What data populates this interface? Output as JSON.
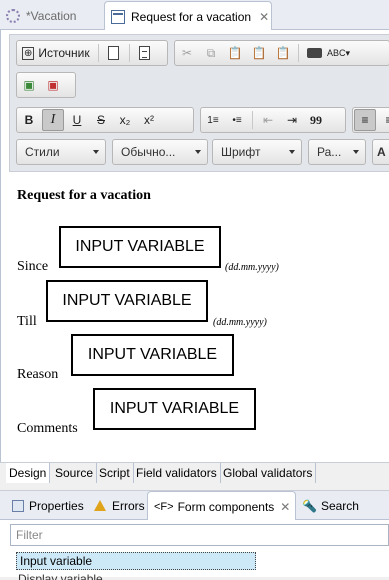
{
  "editor_tabs": [
    {
      "label": "*Vacation",
      "icon": "gear-icon"
    },
    {
      "label": "Request for a vacation",
      "icon": "form-icon"
    }
  ],
  "toolbar": {
    "source_label": "Источник",
    "styles_label": "Стили",
    "format_label": "Обычно...",
    "font_label": "Шрифт",
    "size_label": "Ра...",
    "bold": "B",
    "italic": "I",
    "underline": "U",
    "strike": "S",
    "subscript": "x₂",
    "superscript": "x²",
    "ordered_list": "1≡",
    "bulleted_list": "•≡",
    "blockquote": "99"
  },
  "document": {
    "title": "Request for a vacation",
    "fields": [
      {
        "label": "Since",
        "box": "INPUT VARIABLE",
        "hint": "(dd.mm.yyyy)"
      },
      {
        "label": "Till",
        "box": "INPUT VARIABLE",
        "hint": "(dd.mm.yyyy)"
      },
      {
        "label": "Reason",
        "box": "INPUT VARIABLE",
        "hint": ""
      },
      {
        "label": "Comments",
        "box": "INPUT VARIABLE",
        "hint": ""
      }
    ]
  },
  "mode_tabs": [
    "Design",
    "Source",
    "Script",
    "Field validators",
    "Global validators"
  ],
  "view_tabs": [
    {
      "label": "Properties",
      "icon": "properties-icon"
    },
    {
      "label": "Errors",
      "icon": "warning-icon"
    },
    {
      "label": "Form components",
      "icon": "fx-icon"
    },
    {
      "label": "Search",
      "icon": "search-icon"
    }
  ],
  "view": {
    "filter_placeholder": "Filter",
    "items": [
      "Input variable",
      "Display variable"
    ]
  }
}
